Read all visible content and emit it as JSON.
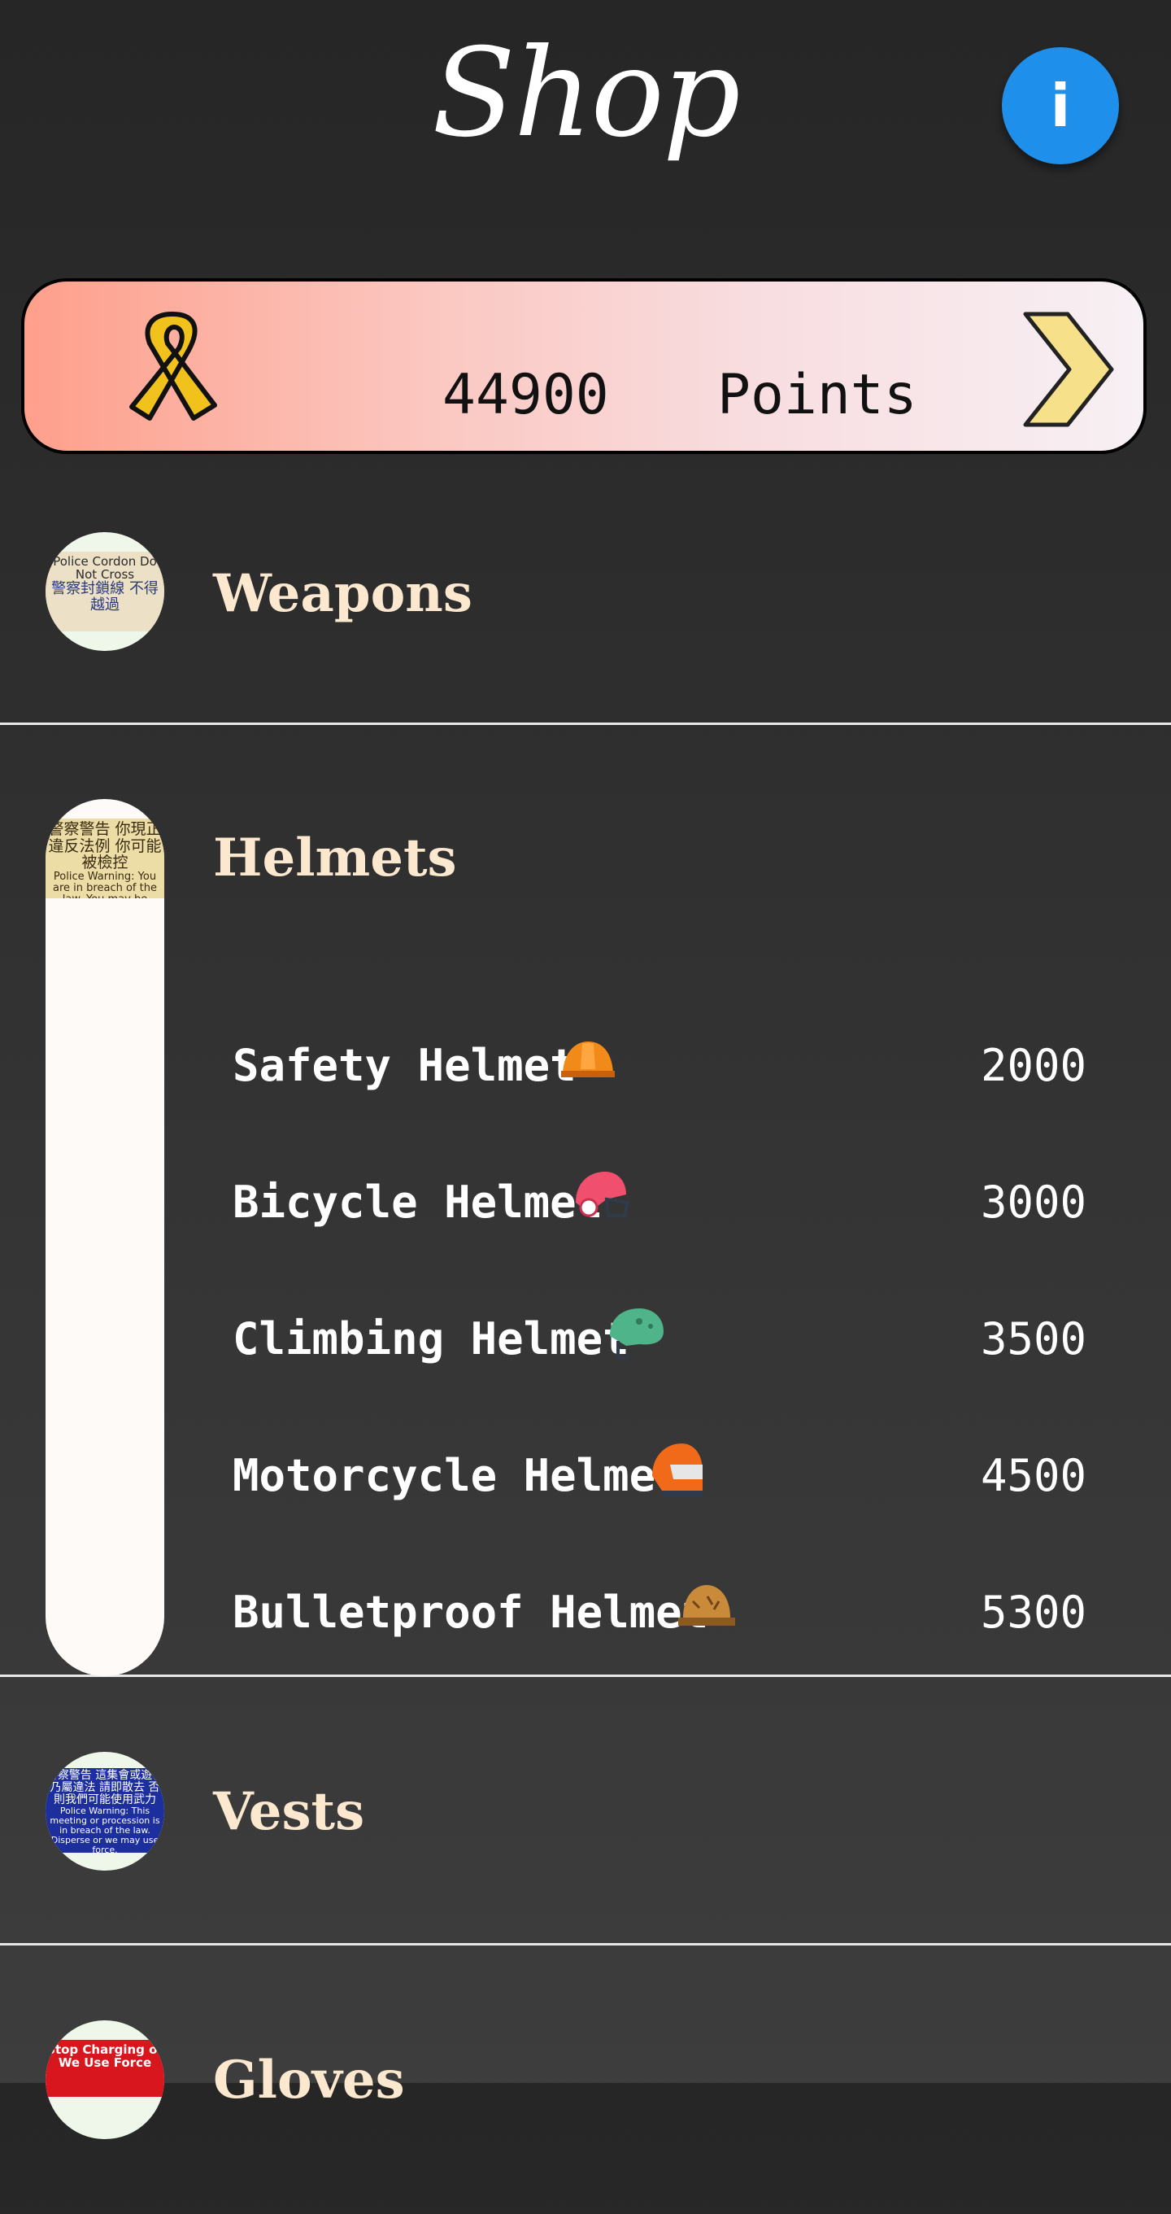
{
  "header": {
    "title": "Shop",
    "info_label": "i"
  },
  "points": {
    "value": "44900",
    "unit": "Points"
  },
  "categories": [
    {
      "name": "Weapons",
      "sign": {
        "en": "Police Cordon Do Not Cross",
        "cn": "警察封鎖線 不得越過"
      }
    },
    {
      "name": "Helmets",
      "sign": {
        "cn": "警察警告 你現正違反法例 你可能被檢控",
        "en": "Police Warning: You are in breach of the law. You may be prosecuted."
      },
      "items": [
        {
          "name": "Safety Helmet",
          "icon": "hard-hat-icon",
          "price": "2000"
        },
        {
          "name": "Bicycle Helmet",
          "icon": "bicycle-helmet-icon",
          "price": "3000"
        },
        {
          "name": "Climbing Helmet",
          "icon": "climbing-helmet-icon",
          "price": "3500"
        },
        {
          "name": "Motorcycle Helmet",
          "icon": "motorcycle-helmet-icon",
          "price": "4500"
        },
        {
          "name": "Bulletproof Helmet",
          "icon": "military-helmet-icon",
          "price": "5300"
        }
      ]
    },
    {
      "name": "Vests",
      "sign": {
        "cn": "警察警告 這集會或遊行乃屬違法 請即散去 否則我們可能使用武力",
        "en": "Police Warning: This meeting or procession is in breach of the law. Disperse or we may use force."
      }
    },
    {
      "name": "Gloves",
      "sign": {
        "en": "Stop Charging or We Use Force"
      }
    }
  ],
  "colors": {
    "background": "#2c2c2c",
    "category_text": "#fbe8cf",
    "info_button": "#1e8fea",
    "divider": "#e8e8e8"
  }
}
